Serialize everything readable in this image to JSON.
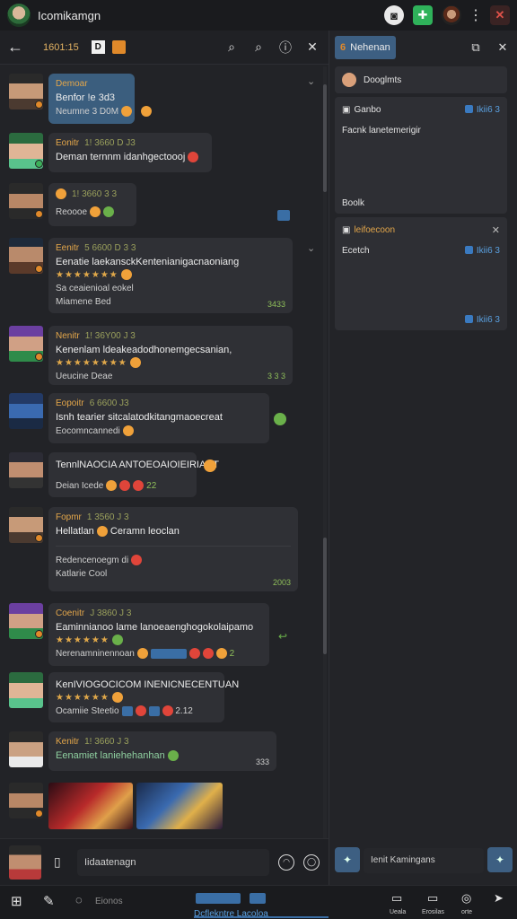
{
  "titlebar": {
    "title": "Icomikamgn"
  },
  "chat": {
    "header": {
      "channel": "1601:15",
      "badge_letter": "D"
    },
    "messages": [
      {
        "name": "Demoar",
        "sub": "",
        "lines": [
          "Benfor !e 3d3"
        ],
        "meta": "Neumne 3 D0M",
        "style": "blue"
      },
      {
        "name": "Eonitr",
        "sub": "1! 3660 D J3",
        "lines": [
          "Deman ternnm idanhgectoooj"
        ]
      },
      {
        "name": "",
        "sub": "1! 3660 3 3",
        "lines": [],
        "meta": "Reoooe"
      },
      {
        "name": "Eenitr",
        "sub": "5 6600 D 3 3",
        "lines": [
          "Eenatie laekansckKentenianigacnaoniang"
        ],
        "stars": "★★★★★★★",
        "meta2": "Sa ceaienioal eokel",
        "meta": "Miamene Bed",
        "time": "3433"
      },
      {
        "name": "Nenitr",
        "sub": "1! 36Y00 J 3",
        "lines": [
          "Kenenlam ldeakeadodhonemgecsanian,"
        ],
        "stars": "★★★★★★★★",
        "meta": "Ueucine Deae",
        "time": "3 3 3"
      },
      {
        "name": "Eopoitr",
        "sub": "6 6600 J3",
        "lines": [
          "Isnh tearier sitcalatodkitangmaoecreat"
        ],
        "meta": "Eocomncannedi"
      },
      {
        "name": "",
        "sub": "",
        "lines": [
          "TennlNAOCIA ANTOEOAIOIEIRIANT"
        ],
        "meta": "Deian Icede",
        "time": "22"
      },
      {
        "name": "Fopmr",
        "sub": "1 3560 J 3",
        "lines": [
          "Hellatlan",
          "Ceramn leoclan"
        ],
        "meta": "Redencenoegm di",
        "meta3": "Katlarie Cool",
        "time": "2003"
      },
      {
        "name": "Coenitr",
        "sub": "J 3860 J 3",
        "lines": [
          "Eaminnianoo lame lanoeaenghogokolaipamo"
        ],
        "stars": "★★★★★★",
        "meta": "Nerenamninennoan",
        "time": "2"
      },
      {
        "name": "",
        "sub": "",
        "lines": [
          "KenIVIOGOCICOM INENICNECENTUAN"
        ],
        "stars": "★★★★★★",
        "meta": "Ocamiie Steetio",
        "time": "2.12"
      },
      {
        "name": "Kenitr",
        "sub": "1! 3660 J 3",
        "lines": [
          "Eenamiet laniehehanhan"
        ],
        "time": "333"
      }
    ],
    "compose_placeholder": "Iidaatenagn"
  },
  "right_panel": {
    "tab_label": "Nehenan",
    "tab_number": "6",
    "search_label": "Dooglmts",
    "card1": {
      "title": "Ganbo",
      "tag": "Ikii6 3",
      "body": "Facnk lanetemerigir",
      "footer": "Boolk"
    },
    "card2": {
      "title": "leifoecoon",
      "row_label": "Ecetch",
      "tag1": "Ikii6 3",
      "tag2": "Ikii6 3"
    },
    "compose_placeholder": "Ienit Kamingans"
  },
  "taskbar": {
    "search_label": "Eionos",
    "item_text": "Dcflekntre Lacoloa",
    "labels": [
      "Ueala",
      "Erosilas",
      "orte"
    ]
  },
  "colors": {
    "accent_blue": "#3d5f82",
    "name_orange": "#e3a64a",
    "time_green": "#8fbf5a",
    "close_red": "#e0524a",
    "online_green": "#2fb25a"
  }
}
